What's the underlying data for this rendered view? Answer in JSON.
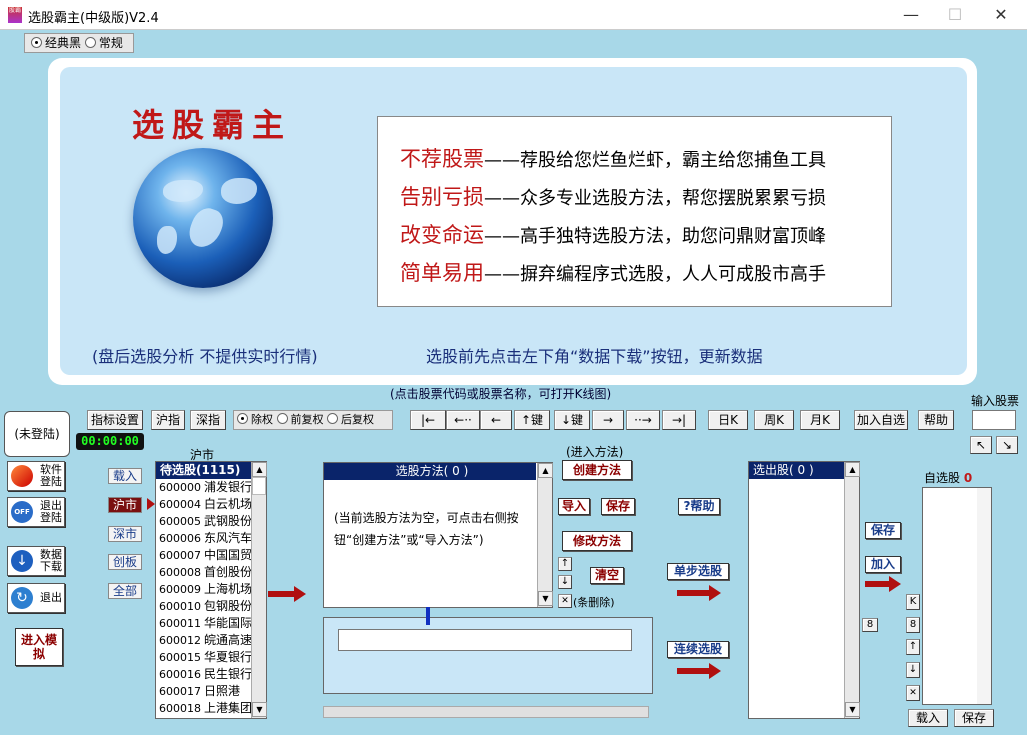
{
  "window": {
    "title": "选股霸主(中级版)V2.4",
    "logo": "股霸",
    "min": "—",
    "max": "☐",
    "close": "✕"
  },
  "theme": {
    "options": [
      "经典黑",
      "常规"
    ],
    "selected": "经典黑"
  },
  "banner": {
    "title": "选股霸主",
    "slogans": [
      {
        "head": "不荐股票",
        "body": "——荐股给您烂鱼烂虾，霸主给您捕鱼工具"
      },
      {
        "head": "告别亏损",
        "body": "——众多专业选股方法，帮您摆脱累累亏损"
      },
      {
        "head": "改变命运",
        "body": "——高手独特选股方法，助您问鼎财富顶峰"
      },
      {
        "head": "简单易用",
        "body": "——摒弃编程序式选股，人人可成股市高手"
      }
    ],
    "footer_left": "(盘后选股分析  不提供实时行情)",
    "footer_right": "选股前先点击左下角“数据下载”按钮，更新数据"
  },
  "hint": "(点击股票代码或股票名称，可打开K线图)",
  "input_stock_label": "输入股票",
  "toolbar": {
    "indicator": "指标设置",
    "sh_index": "沪指",
    "sz_index": "深指",
    "adjust": [
      "除权",
      "前复权",
      "后复权"
    ],
    "adjust_selected": "除权",
    "nav": [
      "|←",
      "←··",
      "←",
      "↑键",
      "↓键",
      "→",
      "··→",
      "→|"
    ],
    "periods": [
      "日K",
      "周K",
      "月K"
    ],
    "add_fav": "加入自选",
    "help": "帮助"
  },
  "left": {
    "login_status": "(未登陆)",
    "clock": "00:00:00",
    "buttons": [
      {
        "label": "软件登陆",
        "icon": "key-icon"
      },
      {
        "label": "退出登陆",
        "icon": "off-icon"
      },
      {
        "label": "数据下载",
        "icon": "download-icon"
      },
      {
        "label": "退出",
        "icon": "exit-icon"
      }
    ],
    "simulate": "进入模拟"
  },
  "markets": {
    "label": "沪市",
    "items": [
      "载入",
      "沪市",
      "深市",
      "创板",
      "全部"
    ],
    "selected": "沪市"
  },
  "pending": {
    "header": "待选股(1115)",
    "rows": [
      [
        "600000",
        "浦发银行"
      ],
      [
        "600004",
        "白云机场"
      ],
      [
        "600005",
        "武钢股份"
      ],
      [
        "600006",
        "东风汽车"
      ],
      [
        "600007",
        "中国国贸"
      ],
      [
        "600008",
        "首创股份"
      ],
      [
        "600009",
        "上海机场"
      ],
      [
        "600010",
        "包钢股份"
      ],
      [
        "600011",
        "华能国际"
      ],
      [
        "600012",
        "皖通高速"
      ],
      [
        "600015",
        "华夏银行"
      ],
      [
        "600016",
        "民生银行"
      ],
      [
        "600017",
        "日照港"
      ],
      [
        "600018",
        "上港集团"
      ]
    ]
  },
  "method": {
    "header": "选股方法(  0  )",
    "empty_text": "(当前选股方法为空，可点击右侧按钮“创建方法”或“导入方法”)",
    "enter_label": "(进入方法)",
    "create": "创建方法",
    "import": "导入",
    "save": "保存",
    "modify": "修改方法",
    "clear": "清空",
    "delete_label": "(条删除)",
    "help": "?帮助",
    "up": "↑",
    "down": "↓",
    "del": "✕"
  },
  "run": {
    "step": "单步选股",
    "continuous": "连续选股"
  },
  "selected": {
    "header": "选出股(  0  )",
    "save": "保存",
    "add": "加入",
    "num": "8"
  },
  "fav": {
    "label": "自选股",
    "count": "0",
    "side": [
      "K",
      "8",
      "↑",
      "↓",
      "✕"
    ],
    "load": "载入",
    "save": "保存"
  },
  "scroll_up": "▲",
  "scroll_down": "▼",
  "arrow_nw": "↖",
  "arrow_se": "↘"
}
